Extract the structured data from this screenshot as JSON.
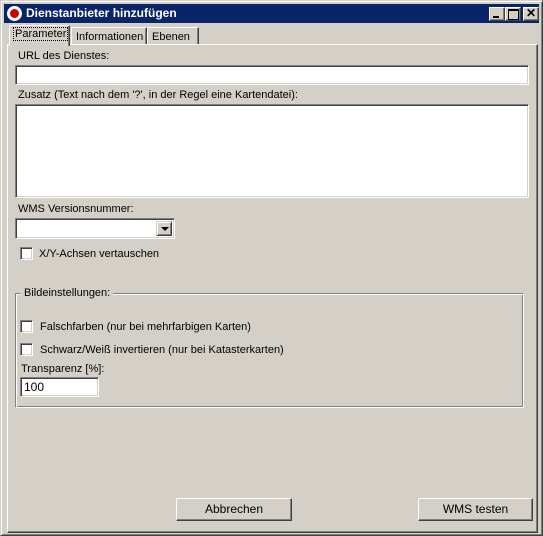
{
  "window": {
    "title": "Dienstanbieter hinzufügen",
    "close_glyph": "✕"
  },
  "tabs": [
    {
      "label": "Parameter",
      "active": true
    },
    {
      "label": "Informationen",
      "active": false
    },
    {
      "label": "Ebenen",
      "active": false
    }
  ],
  "form": {
    "url_label": "URL des Dienstes:",
    "url_value": "",
    "zusatz_label": "Zusatz (Text nach dem '?', in der Regel eine Kartendatei):",
    "zusatz_value": "",
    "wms_version_label": "WMS Versionsnummer:",
    "wms_version_value": "",
    "swap_axes_label": "X/Y-Achsen vertauschen",
    "swap_axes_checked": false
  },
  "image_settings": {
    "title": "Bildeinstellungen:",
    "false_colors_label": "Falschfarben (nur bei mehrfarbigen Karten)",
    "false_colors_checked": false,
    "invert_bw_label": "Schwarz/Weiß invertieren (nur bei Katasterkarten)",
    "invert_bw_checked": false,
    "transparency_label": "Transparenz [%]:",
    "transparency_value": "100"
  },
  "buttons": {
    "cancel_label": "Abbrechen",
    "test_label": "WMS testen"
  },
  "colors": {
    "titlebar": "#0a246a",
    "face": "#d4d0c8",
    "icon_red": "#d40000"
  },
  "icons": [
    "app-icon",
    "minimize-icon",
    "maximize-icon",
    "close-icon",
    "chevron-down-icon"
  ]
}
